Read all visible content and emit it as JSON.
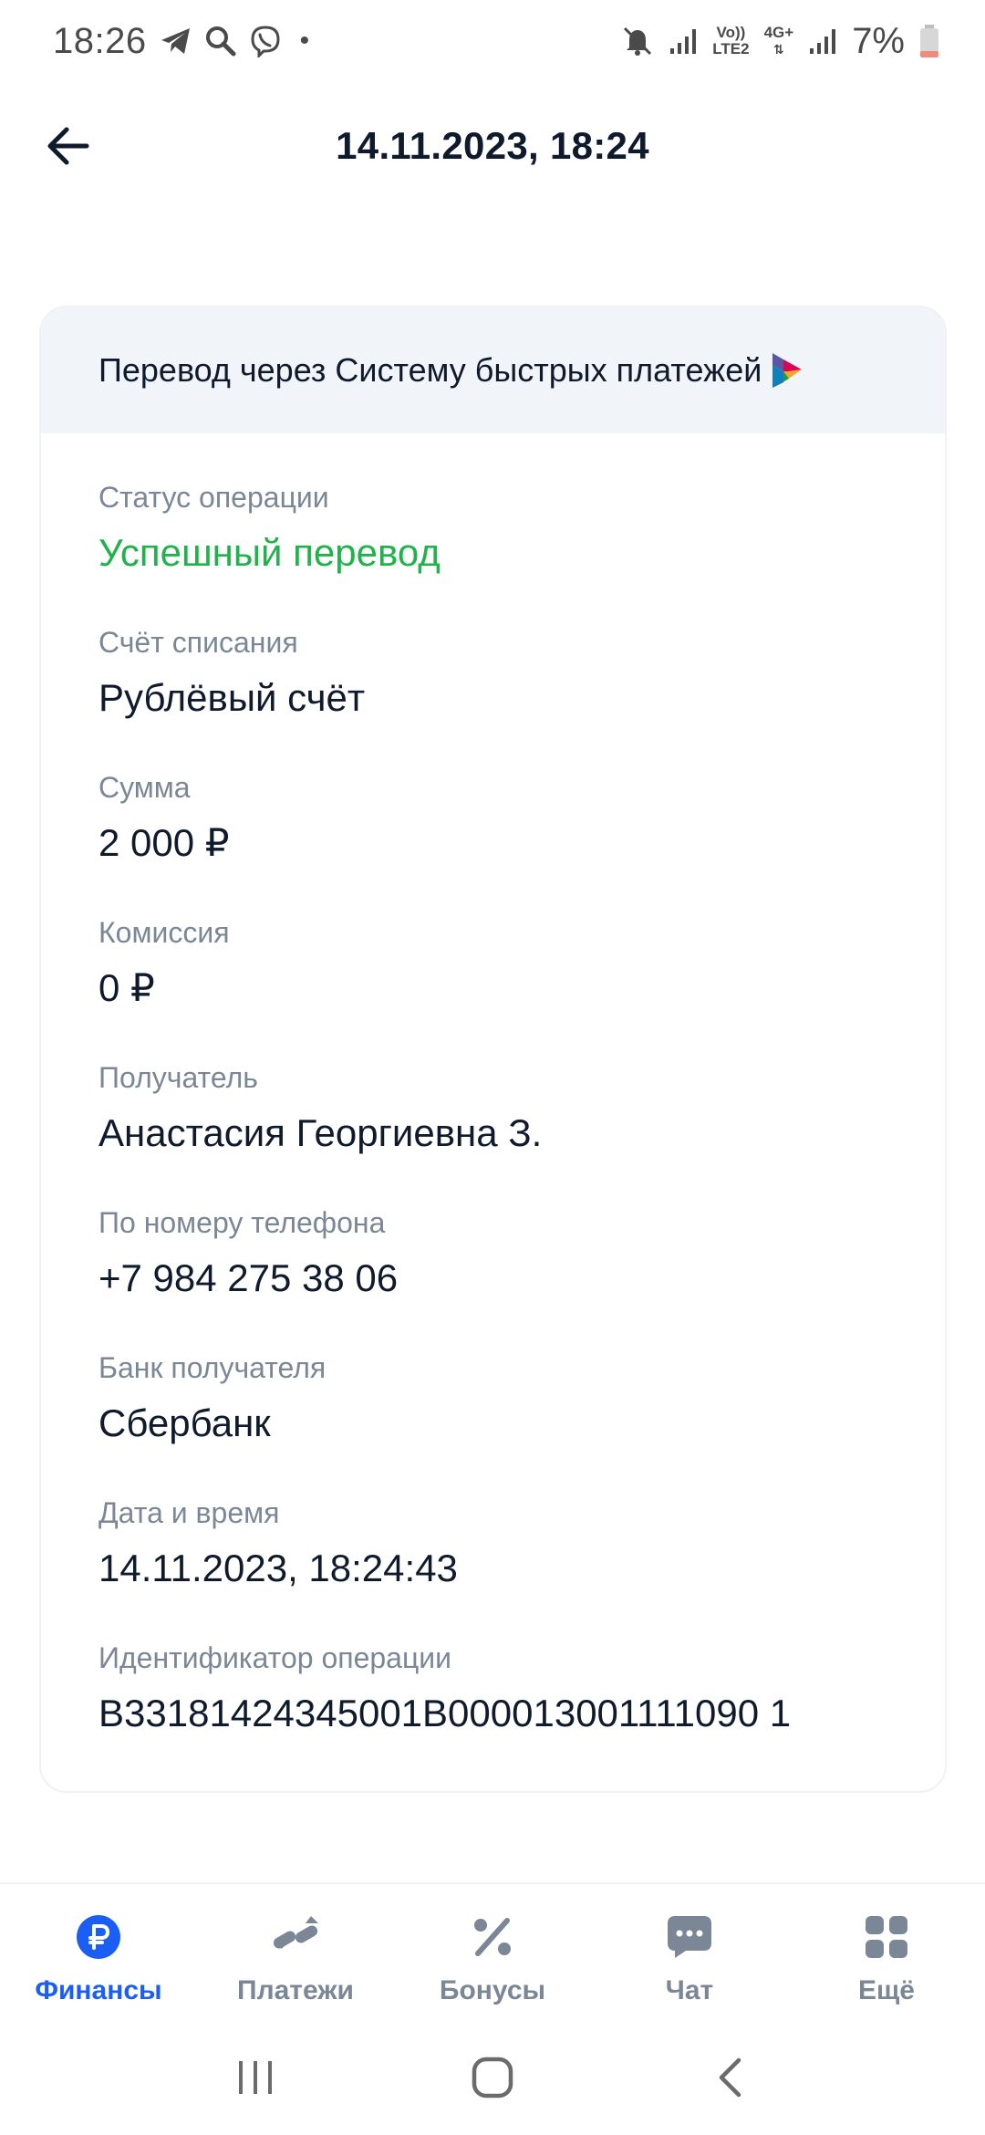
{
  "status_bar": {
    "time": "18:26",
    "dot": "•",
    "lte_top": "Vo))",
    "lte_bottom": "LTE2",
    "net_top": "4G+",
    "battery": "7%"
  },
  "header": {
    "title": "14.11.2023, 18:24"
  },
  "card": {
    "title": "Перевод через Систему быстрых платежей",
    "fields": [
      {
        "label": "Статус операции",
        "value": "Успешный перевод"
      },
      {
        "label": "Счёт списания",
        "value": "Рублёвый счёт"
      },
      {
        "label": "Сумма",
        "value": "2 000 ₽"
      },
      {
        "label": "Комиссия",
        "value": "0 ₽"
      },
      {
        "label": "Получатель",
        "value": "Анастасия Георгиевна З."
      },
      {
        "label": "По номеру телефона",
        "value": "+7 984 275 38 06"
      },
      {
        "label": "Банк получателя",
        "value": "Сбербанк"
      },
      {
        "label": "Дата и время",
        "value": "14.11.2023, 18:24:43"
      },
      {
        "label": "Идентификатор операции",
        "value": "B33181424345001B000013001111090 1"
      }
    ]
  },
  "bottom_nav": {
    "items": [
      {
        "label": "Финансы",
        "icon": "ruble-icon"
      },
      {
        "label": "Платежи",
        "icon": "transfer-arrows-icon"
      },
      {
        "label": "Бонусы",
        "icon": "percent-icon"
      },
      {
        "label": "Чат",
        "icon": "chat-icon"
      },
      {
        "label": "Ещё",
        "icon": "grid-icon"
      }
    ]
  },
  "colors": {
    "accent": "#1b5ef5",
    "success": "#22b24c",
    "muted": "#7b8796",
    "text": "#0f1b2d",
    "card_header_bg": "#f1f4f9"
  }
}
